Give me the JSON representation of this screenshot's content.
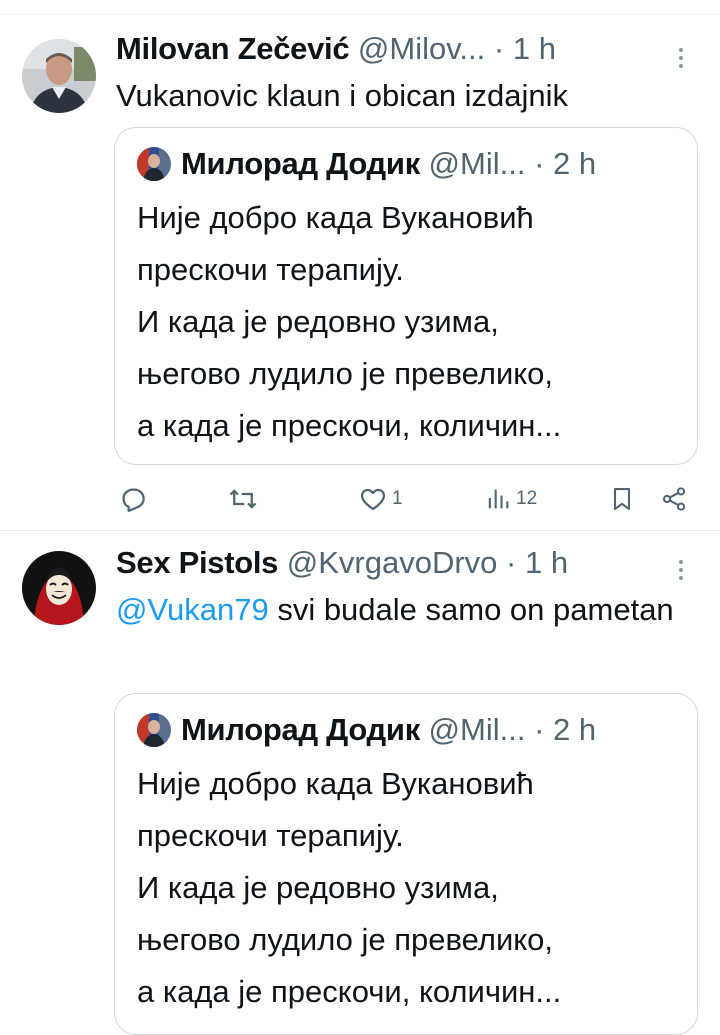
{
  "tweets": [
    {
      "author_name": "Milovan Zečević",
      "author_handle": "@Milov...",
      "separator": "·",
      "time": "1 h",
      "text": "Vukanovic klaun i obican izdajnik",
      "quote": {
        "author_name": "Милорад Додик",
        "author_handle": "@Mil...",
        "separator": "·",
        "time": "2 h",
        "text": "Није добро када Вукановић\nпрескочи терапију.\nИ када је редовно узима,\nњегово лудило је превелико,\nа када је прескочи, количин..."
      },
      "actions": {
        "reply_count": "",
        "retweet_count": "",
        "like_count": "1",
        "view_count": "12"
      }
    },
    {
      "author_name": "Sex Pistols",
      "author_handle": "@KvrgavoDrvo",
      "separator": "·",
      "time": "1 h",
      "mention": "@Vukan79",
      "text": " svi budale samo on pametan",
      "quote": {
        "author_name": "Милорад Додик",
        "author_handle": "@Mil...",
        "separator": "·",
        "time": "2 h",
        "text": "Није добро када Вукановић\nпрескочи терапију.\nИ када је редовно узима,\nњегово лудило је превелико,\nа када је прескочи, количин..."
      }
    }
  ],
  "icons": {
    "reply": "reply-icon",
    "retweet": "retweet-icon",
    "like": "heart-icon",
    "views": "views-icon",
    "bookmark": "bookmark-icon",
    "share": "share-icon",
    "more": "more-vertical-icon"
  },
  "colors": {
    "text": "#0f1419",
    "secondary": "#536471",
    "link": "#1d9bf0",
    "border": "#cfd9de"
  }
}
